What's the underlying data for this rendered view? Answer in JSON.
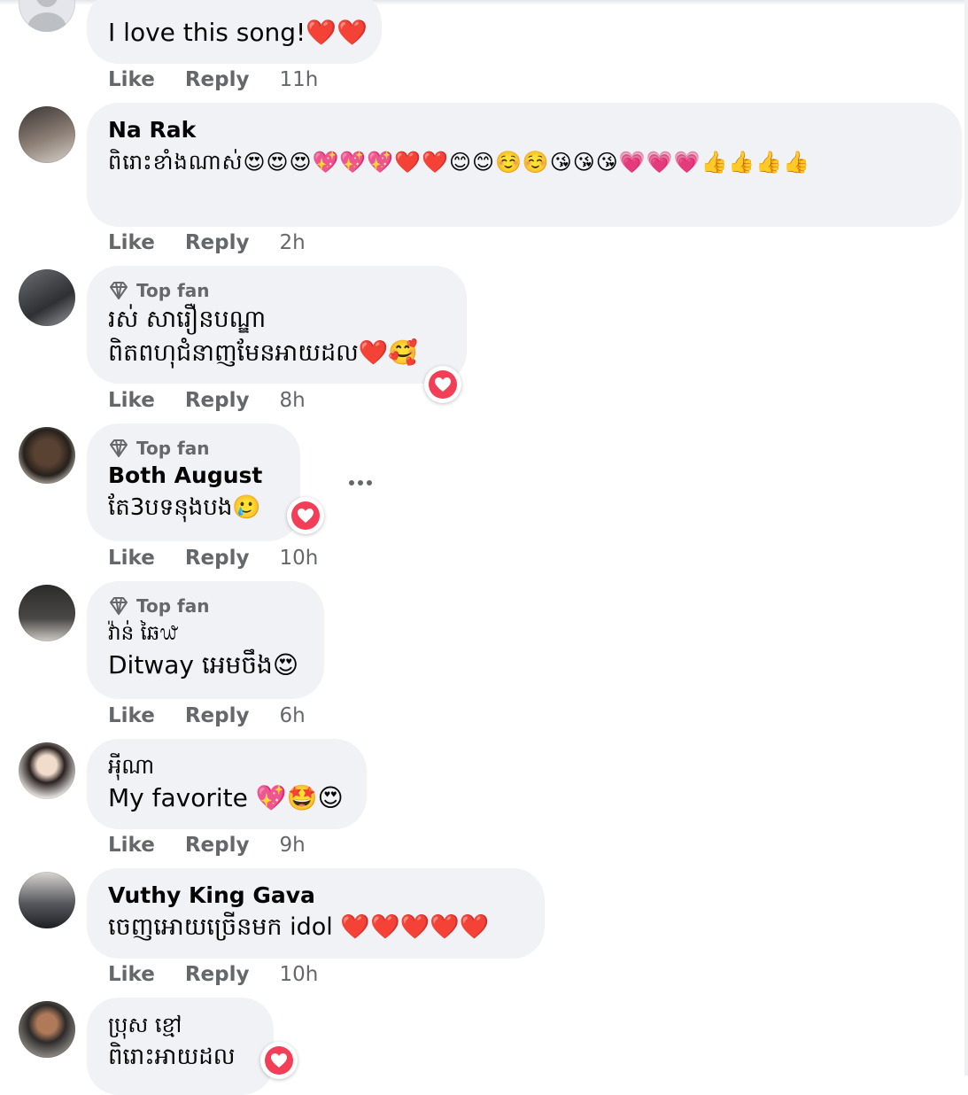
{
  "colors": {
    "bubble": "#f0f2f5",
    "muted": "#65676b",
    "reaction": "#f33e58"
  },
  "comments": [
    {
      "text": "I love this song!❤️❤️",
      "like": "Like",
      "reply": "Reply",
      "time": "11h"
    },
    {
      "author": "Na Rak",
      "text": "ពិរោះខាំងណាស់😍😍😍💖💖💖❤️❤️😊😊☺️☺️😘😘😘💗💗💗👍👍👍👍",
      "like": "Like",
      "reply": "Reply",
      "time": "2h"
    },
    {
      "badge": "Top fan",
      "author": "រស់ សារឿនបណ្ឌា",
      "text": "ពិតពហុជំនាញមែនអាយដល❤️🥰",
      "like": "Like",
      "reply": "Reply",
      "time": "8h"
    },
    {
      "badge": "Top fan",
      "author": "Both August",
      "text": "តែ3បទនុងបង🥲",
      "like": "Like",
      "reply": "Reply",
      "time": "10h"
    },
    {
      "badge": "Top fan",
      "author": "វ៉ាន់ ឆៃ᭙",
      "text": "Ditway អេមចឹង😍",
      "like": "Like",
      "reply": "Reply",
      "time": "6h"
    },
    {
      "author": "អុីណា",
      "text": "My favorite 💖🤩😍",
      "like": "Like",
      "reply": "Reply",
      "time": "9h"
    },
    {
      "author": "Vuthy King Gava",
      "text": "ចេញអោយច្រើនមក idol ❤️❤️❤️❤️❤️",
      "like": "Like",
      "reply": "Reply",
      "time": "10h"
    },
    {
      "author": "ប្រុស ខ្មៅ",
      "text": "ពិរោះអាយដល"
    }
  ],
  "icons": {
    "badge": "diamond-icon",
    "reaction": "heart-icon",
    "more": "more-options-icon"
  }
}
